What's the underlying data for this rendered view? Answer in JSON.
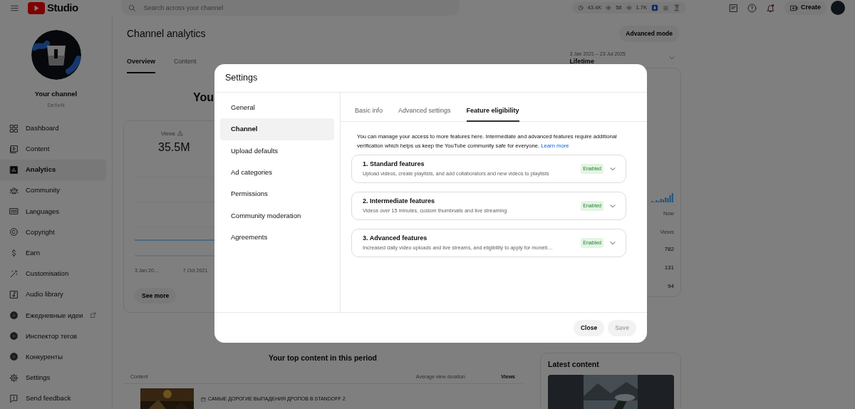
{
  "topbar": {
    "logo": "Studio",
    "search": {
      "placeholder": "Search across your channel"
    },
    "stats": [
      {
        "kind": "clock",
        "value": "43.4K"
      },
      {
        "kind": "eye",
        "value": "58"
      },
      {
        "kind": "eye",
        "value": "1.7K"
      }
    ],
    "create_button": "Create"
  },
  "sidebar": {
    "channel_title": "Your channel",
    "channel_handle": "DeXeN",
    "items": [
      {
        "label": "Dashboard",
        "kind": "dashboard",
        "selected": false,
        "external": false
      },
      {
        "label": "Content",
        "kind": "content",
        "selected": false,
        "external": false
      },
      {
        "label": "Analytics",
        "kind": "analytics",
        "selected": true,
        "external": false
      },
      {
        "label": "Community",
        "kind": "community",
        "selected": false,
        "external": false
      },
      {
        "label": "Languages",
        "kind": "languages",
        "selected": false,
        "external": false
      },
      {
        "label": "Copyright",
        "kind": "copyright",
        "selected": false,
        "external": false
      },
      {
        "label": "Earn",
        "kind": "earn",
        "selected": false,
        "external": false
      },
      {
        "label": "Customisation",
        "kind": "customisation",
        "selected": false,
        "external": false
      },
      {
        "label": "Audio library",
        "kind": "audio",
        "selected": false,
        "external": false
      },
      {
        "label": "Ежедневные идеи",
        "kind": "ext",
        "selected": false,
        "external": true
      },
      {
        "label": "Инспектор тегов",
        "kind": "ext",
        "selected": false,
        "external": false
      },
      {
        "label": "Конкуренты",
        "kind": "ext",
        "selected": false,
        "external": false
      },
      {
        "label": "Settings",
        "kind": "settings",
        "selected": false,
        "external": false
      },
      {
        "label": "Send feedback",
        "kind": "feedback",
        "selected": false,
        "external": false
      }
    ]
  },
  "analytics": {
    "title": "Channel analytics",
    "advanced_button": "Advanced mode",
    "tabs": [
      {
        "label": "Overview",
        "selected": true
      },
      {
        "label": "Content",
        "selected": false
      }
    ],
    "date_range": "3 Jan 2021 – 23 Jul 2025",
    "period": "Lifetime",
    "heading": "You",
    "views_card": {
      "label": "Views",
      "value": "35.5M",
      "axis_labels": [
        "3 Jan 20…",
        "7 Oct 2021"
      ],
      "see_more": "See more"
    },
    "realtime": {
      "now_label": "Now",
      "views_header": "Views",
      "values": [
        "782",
        "131",
        "94"
      ]
    },
    "top_content": {
      "heading": "Your top content in this period",
      "columns": [
        "Content",
        "Average view duration",
        "Views"
      ],
      "rows": [
        {
          "title": "САМЫЕ ДОРОГИЕ ВЫПАДЕНИЯ ДРОПОВ В STANDOFF 2"
        }
      ]
    },
    "latest": {
      "heading": "Latest content"
    }
  },
  "dialog": {
    "title": "Settings",
    "nav": [
      {
        "label": "General",
        "selected": false
      },
      {
        "label": "Channel",
        "selected": true
      },
      {
        "label": "Upload defaults",
        "selected": false
      },
      {
        "label": "Ad categories",
        "selected": false
      },
      {
        "label": "Permissions",
        "selected": false
      },
      {
        "label": "Community moderation",
        "selected": false
      },
      {
        "label": "Agreements",
        "selected": false
      }
    ],
    "tabs": [
      {
        "label": "Basic info",
        "selected": false
      },
      {
        "label": "Advanced settings",
        "selected": false
      },
      {
        "label": "Feature eligibility",
        "selected": true
      }
    ],
    "description": "You can manage your access to more features here. Intermediate and advanced features require additional verification which helps us keep the YouTube community safe for everyone.",
    "link": "Learn more",
    "features": [
      {
        "title": "1. Standard features",
        "description": "Upload videos, create playlists, and add collaborators and new videos to playlists",
        "status": "Enabled",
        "expanded": false
      },
      {
        "title": "2. Intermediate features",
        "description": "Videos over 15 minutes, custom thumbnails and live streaming",
        "status": "Enabled",
        "expanded": false
      },
      {
        "title": "3. Advanced features",
        "description": "Increased daily video uploads and live streams, and eligibility to apply for moneti…",
        "status": "Enabled",
        "expanded": false
      }
    ],
    "close_button": "Close",
    "save_button": {
      "label": "Save",
      "disabled": true
    }
  }
}
